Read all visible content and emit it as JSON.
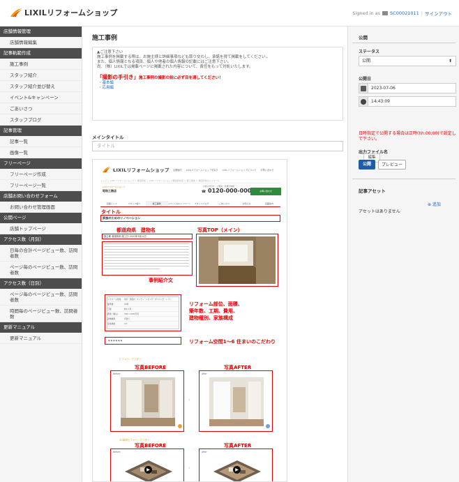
{
  "header": {
    "logo_text": "LIXILリフォームショップ",
    "signed_in_prefix": "Signed in as",
    "user_id": "SC00021011",
    "separator": "|",
    "site_link": "サインアウト"
  },
  "sidebar": {
    "sections": [
      {
        "title": "店舗情報管理",
        "items": [
          "店舗情報編集"
        ]
      },
      {
        "title": "記事軌範作成",
        "items": [
          "施工事例",
          "スタッフ紹介",
          "スタッフ紹介並び替え",
          "イベント&キャンペーン",
          "ごあいさつ",
          "スタッフブログ"
        ]
      },
      {
        "title": "記事管理",
        "items": [
          "記事一覧",
          "画像一覧"
        ]
      },
      {
        "title": "フリーページ",
        "items": [
          "フリーページ作成",
          "フリーページ一覧"
        ]
      },
      {
        "title": "店舗お問い合わせフォーム",
        "items": [
          "お問い合わせ管理画面"
        ]
      },
      {
        "title": "公開ページ",
        "items": [
          "店舗トップページ"
        ]
      },
      {
        "title": "アクセス数（月別）",
        "items": [
          "日毎の合計ページビュー数、訪問者数",
          "ページ毎のページビュー数、訪問者数"
        ]
      },
      {
        "title": "アクセス数（日別）",
        "items": [
          "ページ毎のページビュー数、訪問者数",
          "時間毎のページビュー数、訪問者数"
        ]
      },
      {
        "title": "更新マニュアル",
        "items": [
          "更新マニュアル"
        ]
      }
    ]
  },
  "main": {
    "page_title": "施工事例",
    "notice": {
      "line1": "▲ご注意下さい",
      "line2": "施工事例を掲載する際は、お施主様と詳細事項なども取り交わし、承諾を得て掲載をしてください。",
      "line3": "また、個人情報となる項目、個人や他者の個人情報の記載にはご注意下さい。",
      "line4": "尚、（株）LIXILでは掲載ページに掲載された内容について、責任をもって対処いたします。",
      "guide_title": "「撮影の手引き」",
      "guide_sub": "施工事例の撮影の前に必ず目を通してください！",
      "link1": "・基本編",
      "link2": "・応用編"
    },
    "main_title_label": "メインタイトル",
    "main_title_placeholder": "タイトル"
  },
  "preview": {
    "logo_text": "LIXILリフォームショップ",
    "nav": [
      "店舗案内",
      "LIXILリフォームショップを探す",
      "LIXILリフォームショップについて",
      "お問い合わせ"
    ],
    "breadcrumb": "トップ ＞ LIXILリフォームショップ ＞ 都道府県 ＞ LIXILリフォームショップ都道府県店 ＞ 施工事例 ＞ 都道府県のリフォーム",
    "shop_sub": "LIXILリフォームショップ",
    "shop_name": "昭和工務店",
    "tel_sub": "お問い合わせ・ご相談・見積り依頼",
    "tel": "0120-000-000",
    "contact_button": "お問い合わせ",
    "tabs": [
      "店舗トップ",
      "スタッフ紹介",
      "施工事例",
      "イベント&キャンペーン",
      "スタッフブログ",
      "ごあいさつ",
      "お知らせ",
      "店舗案内"
    ],
    "label_title": "タイトル",
    "sample_title": "家族のためのリノベーション",
    "label_area": "都道府県　建物名",
    "date_line": "施主様: 都道府県 施工日: 2022年3月11日",
    "label_photo_top": "写真TOP（メイン）",
    "label_intro": "事例紹介文",
    "label_spec": "リフォーム部位、面積、\n築年数、工期、費用、\n建物種別、家族構成",
    "spec_rows": [
      [
        "リフォーム部位",
        "浴室・洗面台・キッチン・リビング・ダイニング・トイレ"
      ],
      [
        "築年数",
        "25年"
      ],
      [
        "工期",
        "約1ヶ月"
      ],
      [
        "費用（税込）",
        "500〜1000万円"
      ],
      [
        "建物種別",
        "戸建て"
      ],
      [
        "家族構成",
        "4人"
      ]
    ],
    "label_spaces": "リフォーム空間1〜6 住まいのこだわり",
    "before_after_heading": "ビフォー・アフター",
    "before_after_3d_heading": "3D事例ビフォー・アフター",
    "label_before": "写真BEFORE",
    "label_after": "写真AFTER",
    "before_text": "Before",
    "after_text": "After"
  },
  "right_panel": {
    "publish_heading": "公開",
    "status_label": "ステータス",
    "status_value": "公開",
    "date_label": "公開日",
    "date_value": "2023-07-06",
    "time_value": "14:43:09",
    "warning": "日時指定で公開する場合は正時(hh:00:00)で設定して下さい。",
    "output_label": "出力ファイル名",
    "output_button": "編集",
    "publish_button": "公開",
    "preview_button": "プレビュー",
    "asset_heading": "記事アセット",
    "add_link": "⊕ 追加",
    "no_assets": "アセットはありません"
  },
  "colors": {
    "accent_red": "#e10000",
    "sidebar_header": "#4d4d4d",
    "primary_blue": "#1f5ca8"
  }
}
